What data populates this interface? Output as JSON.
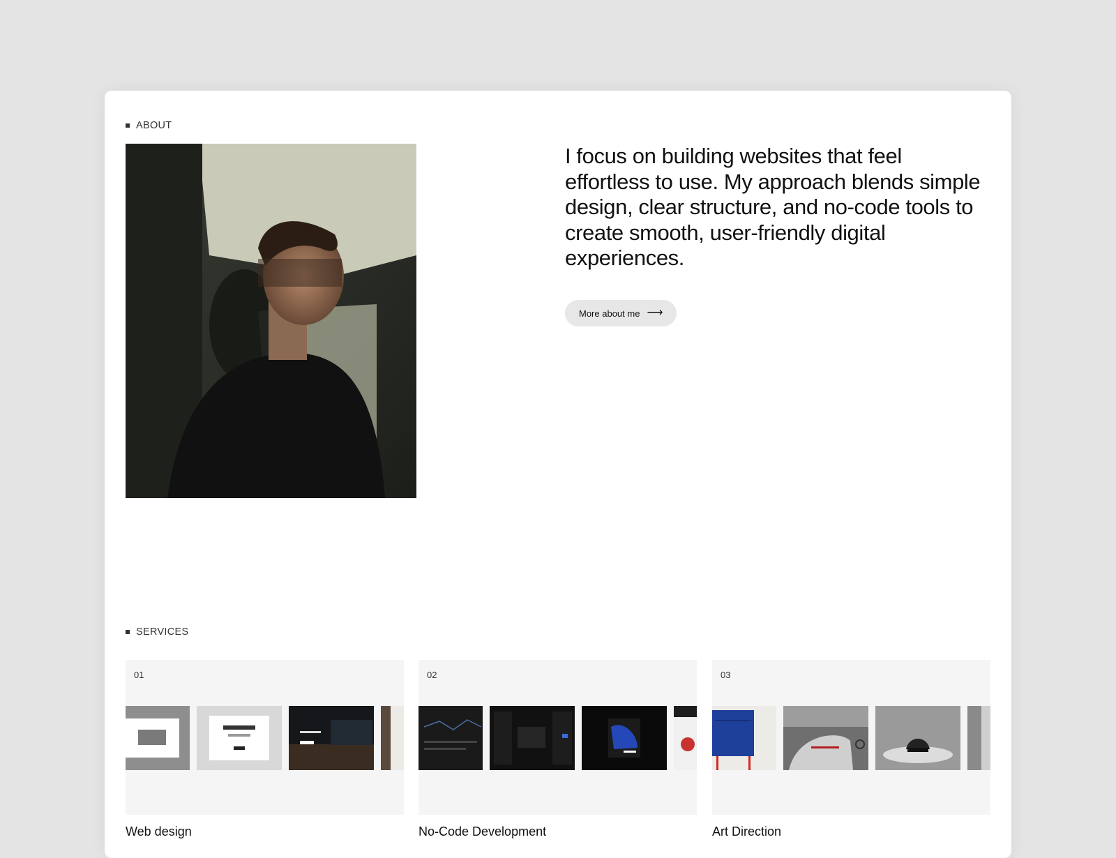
{
  "about": {
    "label": "ABOUT",
    "intro": "I focus on building websites that feel effortless to use. My approach blends simple design, clear structure, and no-code tools to create smooth, user-friendly digital experiences.",
    "button_label": "More about me",
    "button_icon": "arrow-right-icon"
  },
  "services": {
    "label": "SERVICES",
    "items": [
      {
        "number": "01",
        "title": "Web design"
      },
      {
        "number": "02",
        "title": "No-Code Development"
      },
      {
        "number": "03",
        "title": "Art Direction"
      }
    ]
  }
}
